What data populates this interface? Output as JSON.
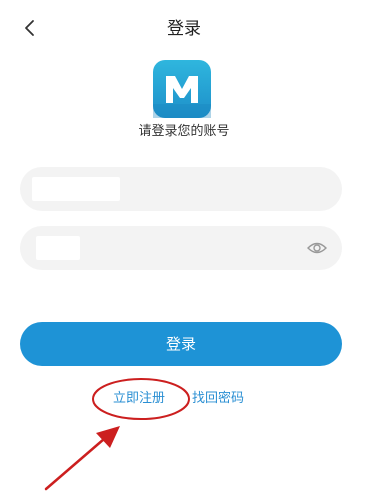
{
  "header": {
    "title": "登录",
    "back_icon": "chevron-left-icon"
  },
  "logo": {
    "icon": "app-logo-m-icon",
    "letter": "M",
    "color": "#1d9ad6"
  },
  "prompt": "请登录您的账号",
  "fields": {
    "account": {
      "value": ""
    },
    "password": {
      "value": "",
      "toggle_icon": "eye-icon"
    }
  },
  "login_button": {
    "label": "登录",
    "color": "#1e93d6"
  },
  "links": {
    "register": "立即注册",
    "forgot_password": "找回密码",
    "color": "#2a8fd3"
  },
  "annotation": {
    "shapes": [
      "red-ellipse",
      "red-arrow"
    ],
    "color": "#cc1f1f"
  }
}
